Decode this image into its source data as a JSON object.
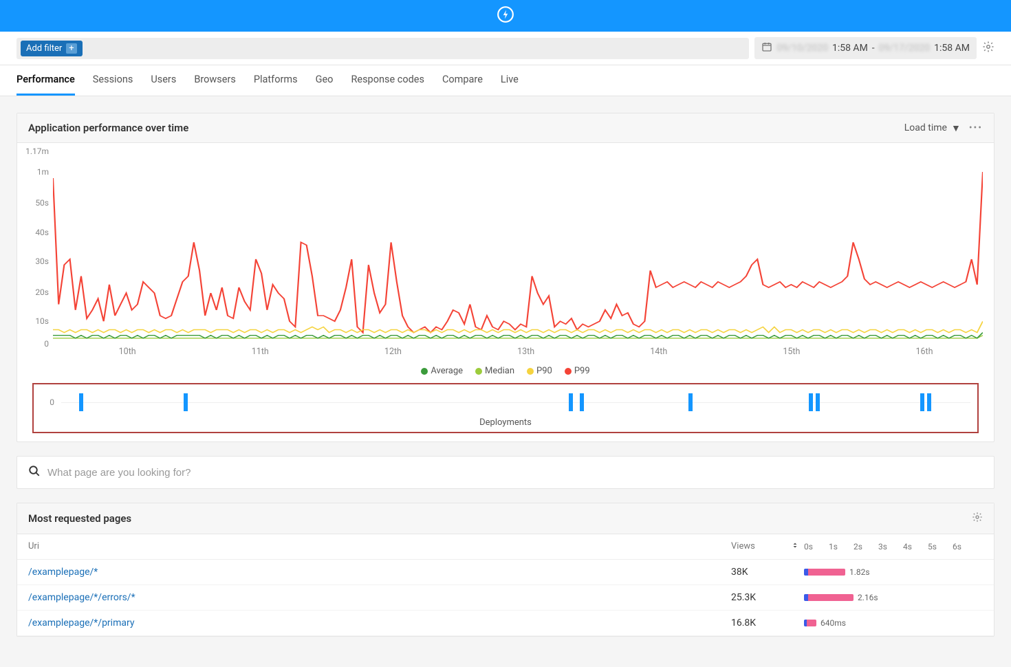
{
  "header": {
    "logo": "lightning"
  },
  "filter_bar": {
    "add_filter_label": "Add filter"
  },
  "date_range": {
    "start_date": "09/10/2020",
    "start_time": "1:58 AM",
    "separator": "-",
    "end_date": "09/17/2020",
    "end_time": "1:58 AM"
  },
  "tabs": [
    "Performance",
    "Sessions",
    "Users",
    "Browsers",
    "Platforms",
    "Geo",
    "Response codes",
    "Compare",
    "Live"
  ],
  "active_tab": "Performance",
  "perf_panel": {
    "title": "Application performance over time",
    "metric_selector": "Load time",
    "y_ticks": [
      "1.17m",
      "1m",
      "50s",
      "40s",
      "30s",
      "20s",
      "10s",
      "0"
    ],
    "x_ticks": [
      "10th",
      "11th",
      "12th",
      "13th",
      "14th",
      "15th",
      "16th"
    ],
    "legend": [
      {
        "label": "Average",
        "color": "#3b9b3b"
      },
      {
        "label": "Median",
        "color": "#9ccc3c"
      },
      {
        "label": "P90",
        "color": "#f5d33f"
      },
      {
        "label": "P99",
        "color": "#f44336"
      }
    ],
    "deployments_label": "Deployments",
    "deployments_zero": "0",
    "deployment_positions_pct": [
      2,
      13.5,
      55.8,
      57,
      69,
      82.2,
      83,
      94.5,
      95.2
    ]
  },
  "search": {
    "placeholder": "What page are you looking for?"
  },
  "pages_panel": {
    "title": "Most requested pages",
    "col_uri": "Uri",
    "col_views": "Views",
    "scale_labels": [
      "0s",
      "1s",
      "2s",
      "3s",
      "4s",
      "5s",
      "6s"
    ],
    "rows": [
      {
        "uri": "/examplepage/*",
        "views": "38K",
        "bar_segments": [
          {
            "w": 6,
            "c": "#3b5be8"
          },
          {
            "w": 54,
            "c": "#f06292"
          }
        ],
        "time_label": "1.82s"
      },
      {
        "uri": "/examplepage/*/errors/*",
        "views": "25.3K",
        "bar_segments": [
          {
            "w": 6,
            "c": "#3b5be8"
          },
          {
            "w": 66,
            "c": "#f06292"
          }
        ],
        "time_label": "2.16s"
      },
      {
        "uri": "/examplepage/*/primary",
        "views": "16.8K",
        "bar_segments": [
          {
            "w": 4,
            "c": "#3b5be8"
          },
          {
            "w": 14,
            "c": "#f06292"
          }
        ],
        "time_label": "640ms"
      }
    ]
  },
  "chart_data": {
    "type": "line",
    "title": "Application performance over time",
    "xlabel": "",
    "ylabel": "Load time",
    "x_days": [
      "10th",
      "11th",
      "12th",
      "13th",
      "14th",
      "15th",
      "16th"
    ],
    "y_ticks_seconds": [
      0,
      10,
      20,
      30,
      40,
      50,
      60,
      70.2
    ],
    "ylim_s": [
      0,
      70.2
    ],
    "note": "y-axis nonlinear above 50s (1m and 1.17m marks). Series sampled ~hourly over 7 days; values in seconds, estimated from gridlines.",
    "series": [
      {
        "name": "P99",
        "color": "#f44336",
        "values_s": [
          58,
          14,
          28,
          30,
          12,
          24,
          9,
          12,
          16,
          8,
          21,
          10,
          14,
          18,
          12,
          14,
          22,
          20,
          18,
          10,
          9,
          10,
          16,
          22,
          24,
          36,
          26,
          10,
          18,
          12,
          20,
          10,
          9,
          20,
          15,
          12,
          30,
          25,
          12,
          21,
          18,
          16,
          8,
          6,
          36,
          35,
          24,
          10,
          10,
          9,
          8,
          12,
          20,
          30,
          6,
          4,
          28,
          18,
          11,
          14,
          36,
          22,
          10,
          6,
          4,
          5,
          6,
          4,
          6,
          5,
          8,
          12,
          11,
          7,
          14,
          6,
          5,
          10,
          6,
          5,
          8,
          7,
          5,
          7,
          6,
          24,
          18,
          14,
          17,
          6,
          8,
          7,
          9,
          5,
          7,
          6,
          7,
          8,
          12,
          9,
          14,
          10,
          11,
          7,
          6,
          8,
          26,
          20,
          21,
          22,
          20,
          21,
          22,
          21,
          20,
          22,
          21,
          20,
          22,
          21,
          20,
          21,
          22,
          24,
          28,
          30,
          21,
          20,
          21,
          22,
          20,
          21,
          20,
          22,
          21,
          20,
          22,
          21,
          20,
          21,
          22,
          24,
          36,
          30,
          23,
          21,
          22,
          21,
          20,
          21,
          22,
          21,
          20,
          21,
          22,
          21,
          20,
          21,
          22,
          21,
          20,
          21,
          22,
          30,
          21,
          60
        ]
      },
      {
        "name": "P90",
        "color": "#f5d33f",
        "values_s": [
          5,
          5,
          4,
          5,
          4,
          5,
          5,
          4,
          5,
          4,
          5,
          5,
          4,
          5,
          4,
          5,
          5,
          4,
          5,
          4,
          5,
          5,
          4,
          5,
          4,
          5,
          5,
          5,
          4,
          5,
          5,
          5,
          4,
          5,
          4,
          5,
          5,
          4,
          5,
          4,
          5,
          5,
          4,
          5,
          4,
          5,
          6,
          5,
          6,
          4,
          5,
          5,
          4,
          5,
          4,
          5,
          5,
          4,
          5,
          4,
          5,
          5,
          4,
          5,
          4,
          5,
          5,
          4,
          5,
          4,
          5,
          5,
          4,
          5,
          4,
          5,
          5,
          4,
          5,
          4,
          5,
          5,
          4,
          5,
          4,
          5,
          5,
          4,
          5,
          4,
          5,
          5,
          4,
          5,
          4,
          5,
          5,
          4,
          5,
          4,
          5,
          5,
          4,
          5,
          4,
          5,
          5,
          4,
          5,
          4,
          5,
          5,
          4,
          5,
          4,
          5,
          5,
          4,
          5,
          4,
          5,
          5,
          4,
          5,
          4,
          5,
          6,
          4,
          6,
          4,
          5,
          5,
          4,
          5,
          4,
          5,
          5,
          4,
          5,
          4,
          5,
          5,
          4,
          5,
          4,
          5,
          5,
          4,
          5,
          4,
          5,
          5,
          4,
          5,
          4,
          5,
          5,
          4,
          5,
          4,
          5,
          5,
          4,
          5,
          4,
          8
        ]
      },
      {
        "name": "Median",
        "color": "#9ccc3c",
        "values_s": [
          2,
          2,
          2,
          2,
          2,
          2,
          2,
          2,
          2,
          2,
          2,
          2,
          2,
          2,
          2,
          2,
          2,
          2,
          2,
          2,
          2,
          2,
          2,
          2,
          2,
          2,
          2,
          2,
          2,
          2,
          2,
          2,
          2,
          2,
          2,
          2,
          2,
          2,
          2,
          2,
          2,
          2,
          2,
          2,
          2,
          2,
          2,
          2,
          2,
          2,
          2,
          2,
          2,
          2,
          2,
          2,
          2,
          2,
          2,
          2,
          2,
          2,
          2,
          2,
          2,
          2,
          2,
          2,
          2,
          2,
          2,
          2,
          2,
          2,
          2,
          2,
          2,
          2,
          2,
          2,
          2,
          2,
          2,
          2,
          2,
          2,
          2,
          2,
          2,
          2,
          2,
          2,
          2,
          2,
          2,
          2,
          2,
          2,
          2,
          2,
          2,
          2,
          2,
          2,
          2,
          2,
          2,
          2,
          2,
          2,
          2,
          2,
          2,
          2,
          2,
          2,
          2,
          2,
          2,
          2,
          2,
          2,
          2,
          2,
          2,
          2,
          2,
          2,
          2,
          2,
          2,
          2,
          2,
          2,
          2,
          2,
          2,
          2,
          2,
          2,
          2,
          2,
          2,
          2,
          2,
          2,
          2,
          2,
          2,
          2,
          2,
          2,
          2,
          2,
          2,
          2,
          2,
          2,
          2,
          2,
          2,
          2,
          2,
          2,
          2,
          3
        ]
      },
      {
        "name": "Average",
        "color": "#3b9b3b",
        "values_s": [
          3,
          3,
          3,
          3,
          2,
          3,
          2,
          3,
          3,
          2,
          3,
          2,
          3,
          3,
          2,
          3,
          2,
          3,
          3,
          2,
          3,
          2,
          3,
          3,
          3,
          3,
          3,
          2,
          3,
          2,
          3,
          3,
          2,
          3,
          2,
          3,
          3,
          2,
          3,
          2,
          3,
          3,
          2,
          3,
          2,
          3,
          3,
          2,
          3,
          2,
          3,
          3,
          2,
          3,
          2,
          3,
          3,
          2,
          3,
          2,
          3,
          3,
          2,
          3,
          2,
          3,
          3,
          2,
          3,
          2,
          3,
          3,
          2,
          3,
          2,
          3,
          3,
          2,
          3,
          2,
          3,
          3,
          2,
          3,
          2,
          3,
          3,
          2,
          3,
          2,
          3,
          3,
          2,
          3,
          2,
          3,
          3,
          2,
          3,
          2,
          3,
          3,
          2,
          3,
          2,
          3,
          3,
          2,
          3,
          2,
          3,
          3,
          2,
          3,
          2,
          3,
          3,
          2,
          3,
          2,
          3,
          3,
          2,
          3,
          2,
          3,
          3,
          2,
          3,
          2,
          3,
          3,
          2,
          3,
          2,
          3,
          3,
          2,
          3,
          2,
          3,
          3,
          2,
          3,
          2,
          3,
          3,
          2,
          3,
          2,
          3,
          3,
          2,
          3,
          2,
          3,
          3,
          2,
          3,
          2,
          3,
          3,
          2,
          3,
          2,
          4
        ]
      }
    ],
    "deployments_track": {
      "zero_label": "0",
      "positions_pct": [
        2,
        13.5,
        55.8,
        57,
        69,
        82.2,
        83,
        94.5,
        95.2
      ]
    }
  }
}
